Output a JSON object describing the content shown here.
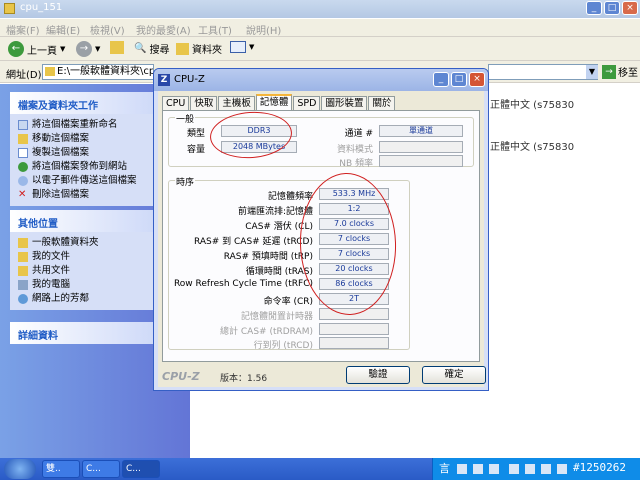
{
  "explorer": {
    "title": "cpu_151",
    "menu": [
      "檔案(F)",
      "編輯(E)",
      "檢視(V)",
      "我的最愛(A)",
      "工具(T)",
      "說明(H)"
    ],
    "toolbar": {
      "back": "上一頁",
      "search": "搜尋",
      "folders": "資料夾"
    },
    "address_label": "網址(D)",
    "address_value": "E:\\一般軟體資料夾\\cpu",
    "go_label": "移至",
    "file_tasks": {
      "title": "檔案及資料夾工作",
      "items": [
        "將這個檔案重新命名",
        "移動這個檔案",
        "複製這個檔案",
        "將這個檔案發佈到網站",
        "以電子郵件傳送這個檔案",
        "刪除這個檔案"
      ]
    },
    "other_places": {
      "title": "其他位置",
      "items": [
        "一般軟體資料夾",
        "我的文件",
        "共用文件",
        "我的電腦",
        "網路上的芳鄰"
      ]
    },
    "details": {
      "title": "詳細資料"
    },
    "right_items": [
      "正體中文 (s75830",
      "正體中文 (s75830"
    ]
  },
  "cpuz": {
    "title": "CPU-Z",
    "tabs": [
      "CPU",
      "快取",
      "主機板",
      "記憶體",
      "SPD",
      "圖形裝置",
      "關於"
    ],
    "active_tab": "記憶體",
    "general": {
      "title": "一般",
      "type_label": "類型",
      "type_value": "DDR3",
      "size_label": "容量",
      "size_value": "2048 MBytes",
      "channel_label": "通道 #",
      "channel_value": "單通道",
      "mode_label": "資料模式",
      "mode_value": "",
      "nb_label": "NB 頻率",
      "nb_value": ""
    },
    "timings": {
      "title": "時序",
      "rows": [
        {
          "label": "記憶體頻率",
          "value": "533.3 MHz"
        },
        {
          "label": "前端匯流排:記憶體",
          "value": "1:2"
        },
        {
          "label": "CAS# 潛伏 (CL)",
          "value": "7.0 clocks"
        },
        {
          "label": "RAS# 到 CAS# 延遲 (tRCD)",
          "value": "7 clocks"
        },
        {
          "label": "RAS# 預填時間 (tRP)",
          "value": "7 clocks"
        },
        {
          "label": "循環時間 (tRAS)",
          "value": "20 clocks"
        },
        {
          "label": "Row Refresh Cycle Time (tRFC)",
          "value": "86 clocks"
        },
        {
          "label": "命令率 (CR)",
          "value": "2T"
        },
        {
          "label": "記憶體閒置計時器",
          "value": ""
        },
        {
          "label": "總計 CAS# (tRDRAM)",
          "value": ""
        },
        {
          "label": "行到列 (tRCD)",
          "value": ""
        }
      ]
    },
    "brand": "CPU-Z",
    "version": "版本：1.56",
    "validate_label": "驗證",
    "ok_label": "確定"
  },
  "taskbar": {
    "items": [
      "雙..",
      "C...",
      "C..."
    ],
    "ime": "言",
    "watermark": "#1250262"
  }
}
